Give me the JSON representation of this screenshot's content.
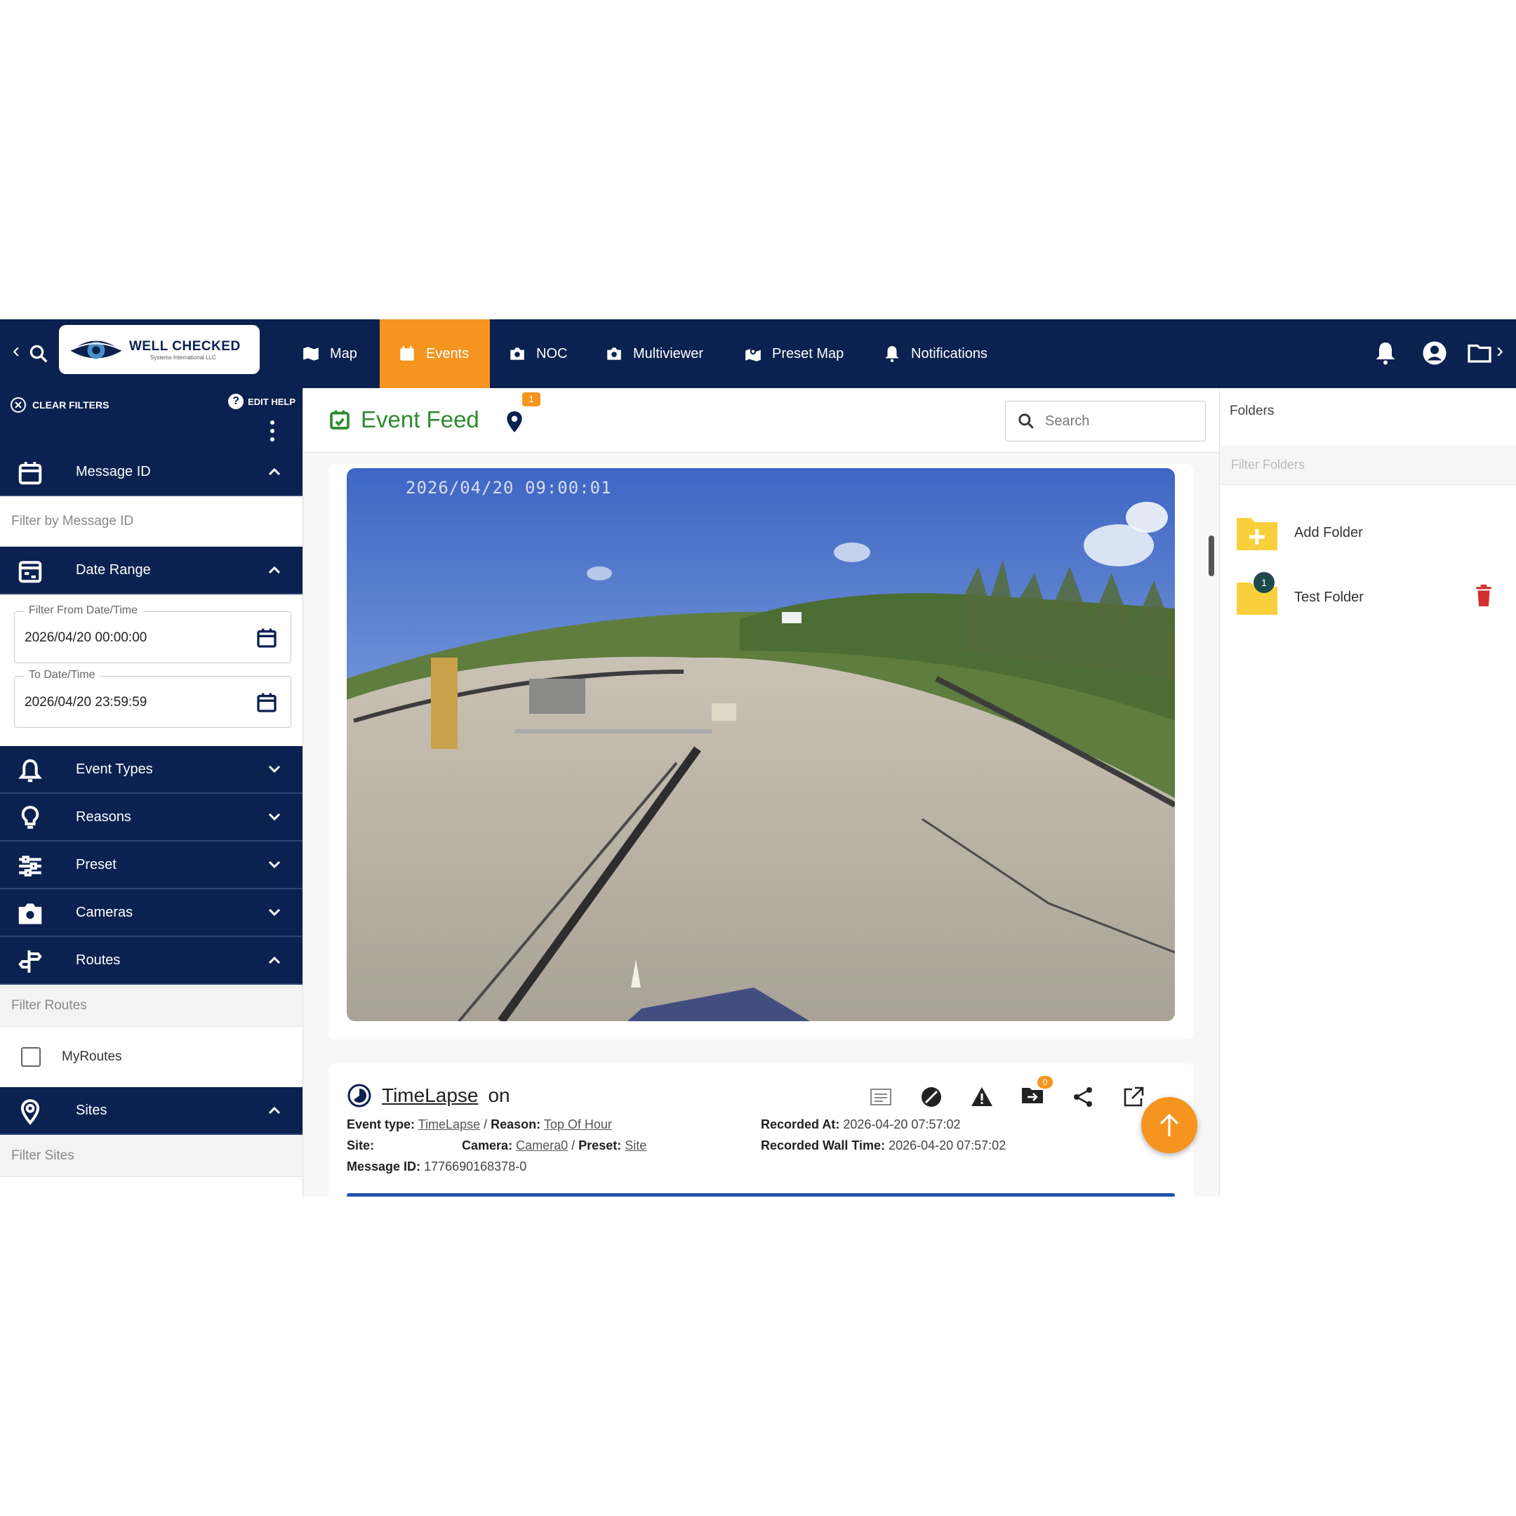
{
  "brand": {
    "name": "WELL CHECKED",
    "tagline": "Systems International LLC"
  },
  "nav": {
    "items": [
      {
        "label": "Map",
        "icon": "map-icon"
      },
      {
        "label": "Events",
        "icon": "calendar-icon",
        "active": true
      },
      {
        "label": "NOC",
        "icon": "camera-icon"
      },
      {
        "label": "Multiviewer",
        "icon": "camera-icon"
      },
      {
        "label": "Preset Map",
        "icon": "map-marker-icon"
      },
      {
        "label": "Notifications",
        "icon": "bell-icon"
      }
    ]
  },
  "sidebar": {
    "clear_filters": "CLEAR FILTERS",
    "edit_help": "EDIT HELP",
    "message_id": {
      "title": "Message ID",
      "placeholder": "Filter by Message ID"
    },
    "date_range": {
      "title": "Date Range",
      "from_label": "Filter From Date/Time",
      "from_value": "2026/04/20 00:00:00",
      "to_label": "To Date/Time",
      "to_value": "2026/04/20 23:59:59"
    },
    "event_types": "Event Types",
    "reasons": "Reasons",
    "preset": "Preset",
    "cameras": "Cameras",
    "routes": {
      "title": "Routes",
      "filter": "Filter Routes",
      "option": "MyRoutes"
    },
    "sites": {
      "title": "Sites",
      "filter": "Filter Sites"
    }
  },
  "feed": {
    "title": "Event Feed",
    "pin_badge": "1",
    "search_placeholder": "Search",
    "image_timestamp": "2026/04/20 09:00:01",
    "event": {
      "title_link": "TimeLapse",
      "title_suffix": "on",
      "event_type_label": "Event type:",
      "event_type": "TimeLapse",
      "reason_label": "Reason:",
      "reason": "Top Of Hour",
      "site_label": "Site:",
      "camera_label": "Camera:",
      "camera": "Camera0",
      "preset_label": "Preset:",
      "preset": "Site",
      "message_id_label": "Message ID:",
      "message_id": "1776690168378-0",
      "recorded_at_label": "Recorded At:",
      "recorded_at": "2026-04-20 07:57:02",
      "wall_time_label": "Recorded Wall Time:",
      "wall_time": "2026-04-20 07:57:02",
      "folder_badge": "0",
      "separator": "/"
    }
  },
  "folders": {
    "title": "Folders",
    "filter_placeholder": "Filter Folders",
    "add_label": "Add Folder",
    "items": [
      {
        "name": "Test Folder",
        "count": "1"
      }
    ]
  },
  "colors": {
    "navy": "#0b2150",
    "accent": "#f5941f",
    "green": "#2e8b2e",
    "danger": "#d32f2f"
  }
}
